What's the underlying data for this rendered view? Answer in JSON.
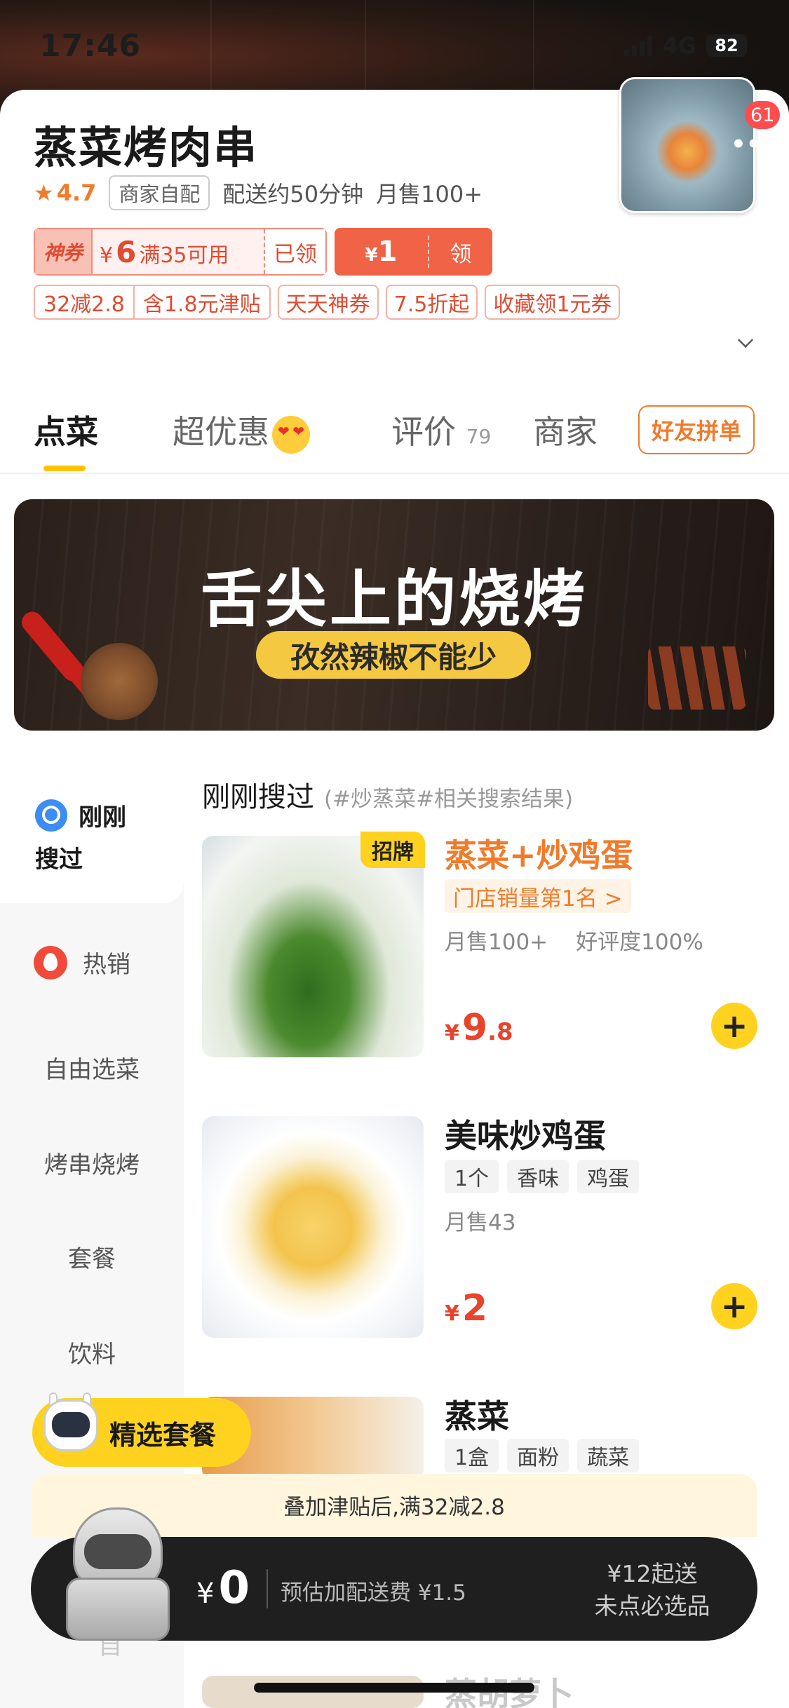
{
  "status_bar": {
    "time": "17:46",
    "network": "4G",
    "battery": "82"
  },
  "shop": {
    "name": "蒸菜烤肉串",
    "rating": "4.7",
    "delivery_tag": "商家自配",
    "delivery_time": "配送约50分钟",
    "monthly_sales": "月售100+",
    "thumb_badge": "61"
  },
  "coupons": {
    "main": {
      "brand": "神券",
      "currency": "¥",
      "amount": "6",
      "condition": "满35可用",
      "status": "已领"
    },
    "red": {
      "currency": "¥",
      "amount": "1",
      "action": "领"
    },
    "promos": [
      "32减2.8",
      "含1.8元津贴",
      "天天神券",
      "7.5折起",
      "收藏领1元券"
    ]
  },
  "tabs": {
    "order": "点菜",
    "deals": "超优惠",
    "reviews": "评价",
    "reviews_count": "79",
    "merchant": "商家",
    "group_order": "好友拼单"
  },
  "banner": {
    "title": "舌尖上的烧烤",
    "subtitle": "孜然辣椒不能少"
  },
  "sidebar": {
    "recent_line1": "刚刚",
    "recent_line2": "搜过",
    "hot": "热销",
    "items": [
      "自由选菜",
      "烤串烧烤",
      "套餐",
      "饮料"
    ],
    "peek": "自"
  },
  "section": {
    "title": "刚刚搜过",
    "subtitle": "(#炒蒸菜#相关搜索结果)"
  },
  "products": [
    {
      "name": "蒸菜+炒鸡蛋",
      "badge": "招牌",
      "rank": "门店销量第1名 >",
      "sales": "月售100+",
      "rating": "好评度100%",
      "currency": "¥",
      "price_int": "9",
      "price_dec": ".8"
    },
    {
      "name": "美味炒鸡蛋",
      "chips": [
        "1个",
        "香味",
        "鸡蛋"
      ],
      "sales": "月售43",
      "currency": "¥",
      "price_int": "2"
    },
    {
      "name": "蒸菜",
      "chips": [
        "1盒",
        "面粉",
        "蔬菜"
      ]
    },
    {
      "name": "蒸胡萝卜"
    }
  ],
  "combo": {
    "label": "精选套餐"
  },
  "cart": {
    "notice": "叠加津贴后,满32减2.8",
    "currency": "¥",
    "total": "0",
    "delivery_fee": "预估加配送费 ¥1.5",
    "min_order": "¥12起送",
    "required": "未点必选品"
  },
  "colors": {
    "accent": "#ffd21f",
    "price": "#e8442a",
    "orange": "#f07b2a",
    "cart_bg": "#1f1f1f"
  }
}
